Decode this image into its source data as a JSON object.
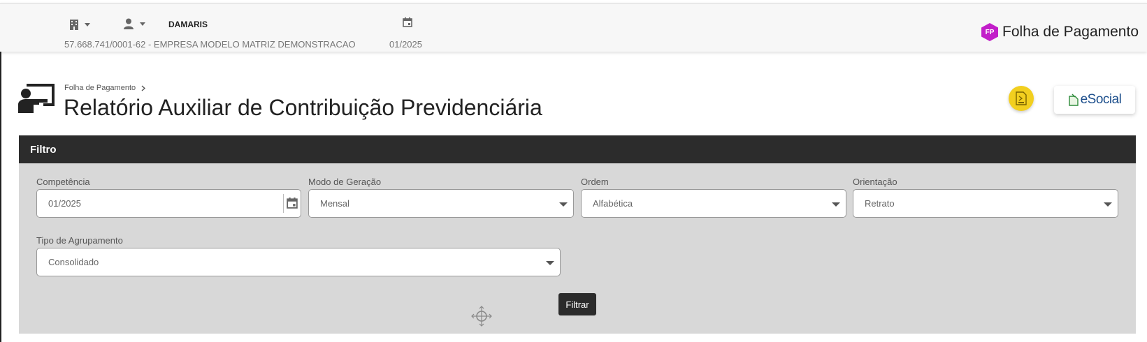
{
  "topbar": {
    "user_name": "DAMARIS",
    "company": "57.668.741/0001-62 - EMPRESA MODELO MATRIZ DEMONSTRACAO",
    "competence": "01/2025",
    "icons": [
      "building-icon",
      "user-icon",
      "calendar-icon"
    ],
    "brand": {
      "badge": "FP",
      "name": "Folha de Pagamento",
      "color": "#c21ec9"
    }
  },
  "breadcrumb": {
    "parent": "Folha de Pagamento"
  },
  "page": {
    "title": "Relatório Auxiliar de Contribuição Previdenciária"
  },
  "actions": {
    "esocial_label": "eSocial",
    "gold_color": "#f2cf1f"
  },
  "filter": {
    "title": "Filtro",
    "fields": [
      {
        "label": "Competência",
        "value": "01/2025",
        "type": "date"
      },
      {
        "label": "Modo de Geração",
        "value": "Mensal",
        "type": "select"
      },
      {
        "label": "Ordem",
        "value": "Alfabética",
        "type": "select"
      },
      {
        "label": "Orientação",
        "value": "Retrato",
        "type": "select"
      },
      {
        "label": "Tipo de Agrupamento",
        "value": "Consolidado",
        "type": "select"
      }
    ],
    "submit_label": "Filtrar"
  }
}
